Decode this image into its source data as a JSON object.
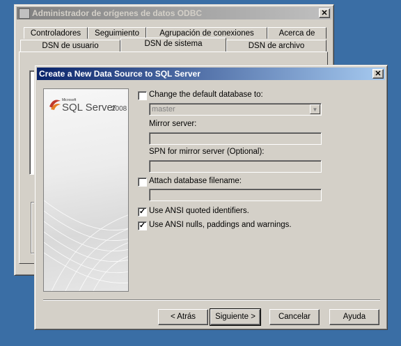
{
  "back_window": {
    "title": "Administrador de orígenes de datos ODBC",
    "close_glyph": "✕",
    "tabs_row1": [
      "Controladores",
      "Seguimiento",
      "Agrupación de conexiones",
      "Acerca de"
    ],
    "tabs_row2": [
      "DSN de usuario",
      "DSN de sistema",
      "DSN de archivo"
    ],
    "active_tab": "DSN de sistema"
  },
  "dialog": {
    "title": "Create a New Data Source to SQL Server",
    "close_glyph": "✕",
    "brand": {
      "small": "Microsoft",
      "name": "SQL Server",
      "year": "2008"
    },
    "change_db": {
      "label": "Change the default database to:",
      "checked": false,
      "check_glyph": ""
    },
    "database_combo": {
      "value": "master",
      "arrow": "▼"
    },
    "mirror_server": {
      "label": "Mirror server:",
      "value": ""
    },
    "spn_mirror": {
      "label": "SPN for mirror server (Optional):",
      "value": ""
    },
    "attach_db": {
      "label": "Attach database filename:",
      "checked": false,
      "check_glyph": "",
      "value": ""
    },
    "ansi_quoted": {
      "label": "Use ANSI quoted identifiers.",
      "checked": true,
      "check_glyph": "✓"
    },
    "ansi_nulls": {
      "label": "Use ANSI nulls, paddings and warnings.",
      "checked": true,
      "check_glyph": "✓"
    },
    "buttons": {
      "back": "< Atrás",
      "next": "Siguiente >",
      "cancel": "Cancelar",
      "help": "Ayuda"
    }
  }
}
